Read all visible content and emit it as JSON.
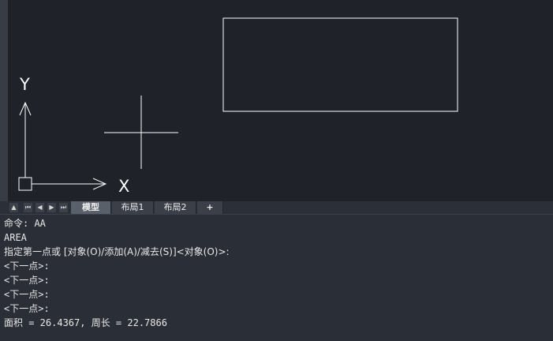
{
  "tabs": [
    {
      "label": "模型",
      "active": true
    },
    {
      "label": "布局1",
      "active": false
    },
    {
      "label": "布局2",
      "active": false
    },
    {
      "label": "+",
      "active": false
    }
  ],
  "nav_buttons": [
    "first",
    "prev",
    "next",
    "last"
  ],
  "ucs": {
    "x_label": "X",
    "y_label": "Y"
  },
  "command_history": [
    "命令: AA",
    "AREA",
    "指定第一点或 [对象(O)/添加(A)/减去(S)]<对象(O)>:",
    "<下一点>:",
    "<下一点>:",
    "<下一点>:",
    "<下一点>:",
    "面积 = 26.4367, 周长 = 22.7866"
  ],
  "colors": {
    "viewport_bg": "#1f2329",
    "geometry": "#ffffff",
    "command_bg": "#2a2e36"
  }
}
